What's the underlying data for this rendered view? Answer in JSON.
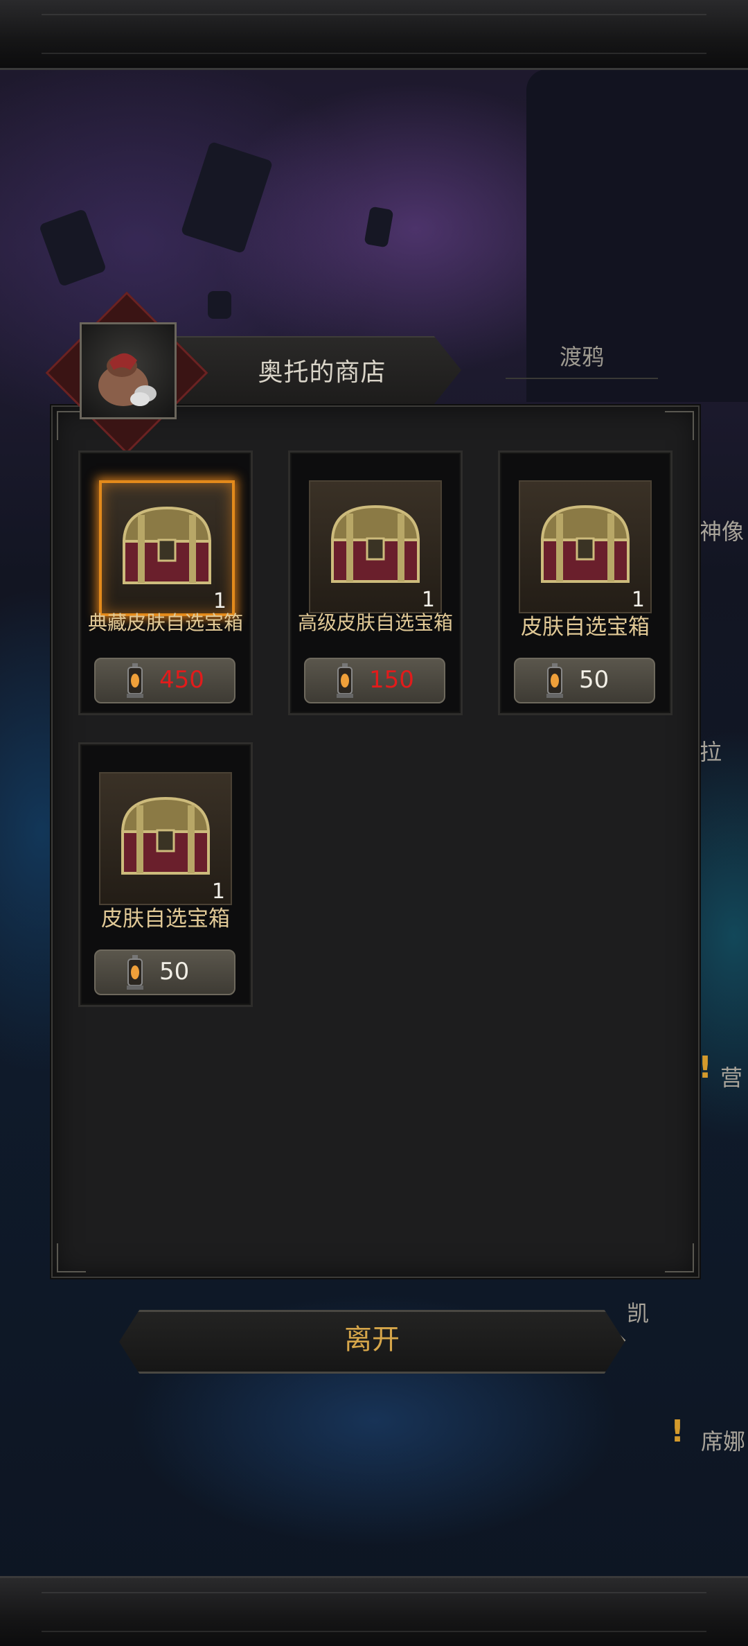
{
  "shop": {
    "title": "奥托的商店",
    "tab_raven": "渡鸦",
    "leave_label": "离开",
    "items": [
      {
        "name": "典藏皮肤自选宝箱",
        "qty": "1",
        "price": "450",
        "price_color": "#e21b1b",
        "selected": true
      },
      {
        "name": "高级皮肤自选宝箱",
        "qty": "1",
        "price": "150",
        "price_color": "#e21b1b",
        "selected": false
      },
      {
        "name": "皮肤自选宝箱",
        "qty": "1",
        "price": "50",
        "price_color": "#f2efe6",
        "selected": false
      },
      {
        "name": "皮肤自选宝箱",
        "qty": "1",
        "price": "50",
        "price_color": "#f2efe6",
        "selected": false
      }
    ]
  },
  "npc_labels": {
    "statue": "神像",
    "la": "拉",
    "camp": "营",
    "kai": "凯",
    "xina": "席娜"
  },
  "colors": {
    "accent_gold": "#d6a64a",
    "price_red": "#e21b1b",
    "selection_orange": "#e38a1b"
  }
}
